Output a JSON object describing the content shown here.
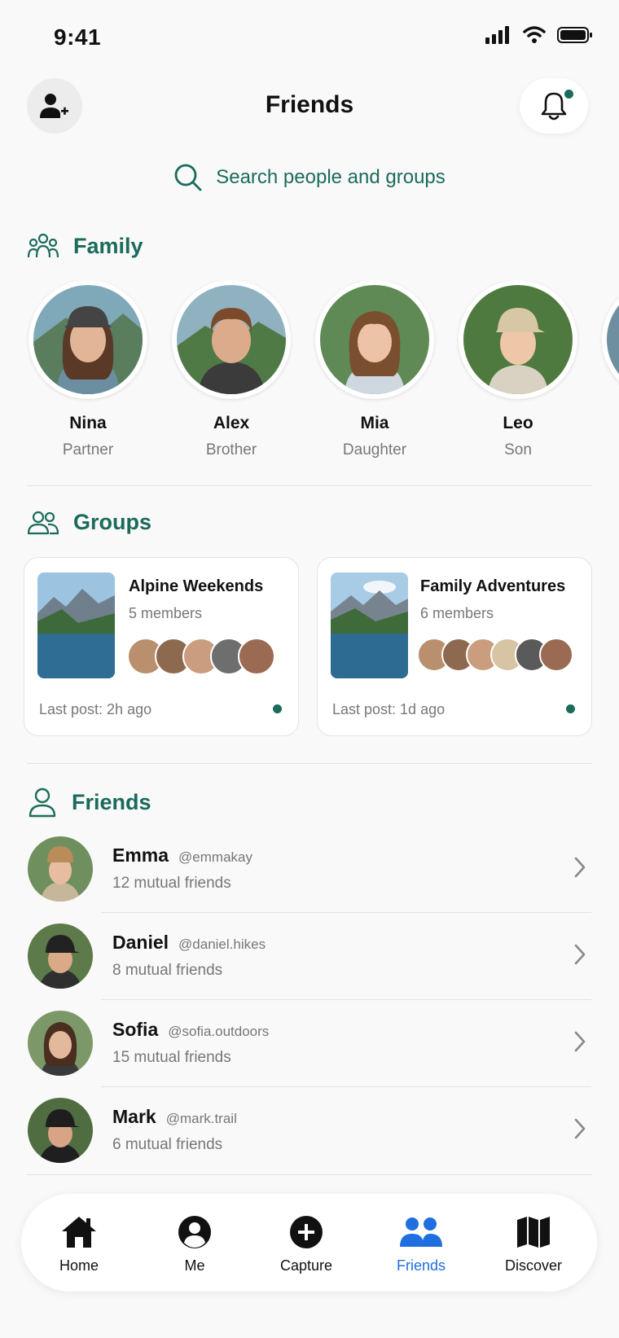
{
  "status_bar": {
    "time": "9:41"
  },
  "header": {
    "title": "Friends"
  },
  "search": {
    "placeholder": "Search people and groups"
  },
  "family": {
    "title": "Family",
    "members": [
      {
        "name": "Nina",
        "relation": "Partner"
      },
      {
        "name": "Alex",
        "relation": "Brother"
      },
      {
        "name": "Mia",
        "relation": "Daughter"
      },
      {
        "name": "Leo",
        "relation": "Son"
      }
    ]
  },
  "groups": {
    "title": "Groups",
    "items": [
      {
        "name": "Alpine Weekends",
        "members": "5 members",
        "last_post": "Last post: 2h ago"
      },
      {
        "name": "Family Adventures",
        "members": "6 members",
        "last_post": "Last post: 1d ago"
      }
    ]
  },
  "friends": {
    "title": "Friends",
    "items": [
      {
        "name": "Emma",
        "handle": "@emmakay",
        "mutual": "12 mutual friends"
      },
      {
        "name": "Daniel",
        "handle": "@daniel.hikes",
        "mutual": "8 mutual friends"
      },
      {
        "name": "Sofia",
        "handle": "@sofia.outdoors",
        "mutual": "15 mutual friends"
      },
      {
        "name": "Mark",
        "handle": "@mark.trail",
        "mutual": "6 mutual friends"
      }
    ]
  },
  "tab_bar": {
    "tabs": [
      {
        "label": "Home",
        "icon": "home-icon"
      },
      {
        "label": "Me",
        "icon": "profile-icon"
      },
      {
        "label": "Capture",
        "icon": "plus-circle-icon"
      },
      {
        "label": "Friends",
        "icon": "friends-icon"
      },
      {
        "label": "Discover",
        "icon": "map-icon"
      }
    ],
    "active": "Friends"
  },
  "colors": {
    "accent": "#1b6b5c",
    "active_tab": "#1f6fe0",
    "background": "#f9f9f9"
  }
}
